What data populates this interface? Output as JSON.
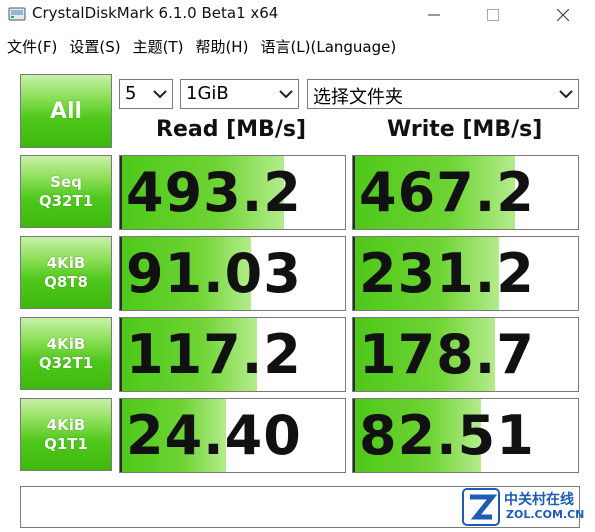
{
  "window": {
    "title": "CrystalDiskMark 6.1.0 Beta1 x64"
  },
  "menu": {
    "items": [
      "文件(F)",
      "设置(S)",
      "主题(T)",
      "帮助(H)",
      "语言(L)(Language)"
    ]
  },
  "controls": {
    "all_label": "All",
    "count_value": "5",
    "size_value": "1GiB",
    "drive_value": "选择文件夹"
  },
  "headers": {
    "read": "Read [MB/s]",
    "write": "Write [MB/s]"
  },
  "rows": [
    {
      "label_line1": "Seq",
      "label_line2": "Q32T1",
      "read": "493.2",
      "write": "467.2",
      "read_fill": 0.73,
      "write_fill": 0.72
    },
    {
      "label_line1": "4KiB",
      "label_line2": "Q8T8",
      "read": "91.03",
      "write": "231.2",
      "read_fill": 0.58,
      "write_fill": 0.65
    },
    {
      "label_line1": "4KiB",
      "label_line2": "Q32T1",
      "read": "117.2",
      "write": "178.7",
      "read_fill": 0.61,
      "write_fill": 0.63
    },
    {
      "label_line1": "4KiB",
      "label_line2": "Q1T1",
      "read": "24.40",
      "write": "82.51",
      "read_fill": 0.47,
      "write_fill": 0.57
    }
  ],
  "watermark": {
    "cn_text": "中关村在线",
    "en_text": "ZOL.COM.CN"
  },
  "colors": {
    "accent_green": "#4ec81a",
    "watermark_blue": "#1e5cb3"
  }
}
